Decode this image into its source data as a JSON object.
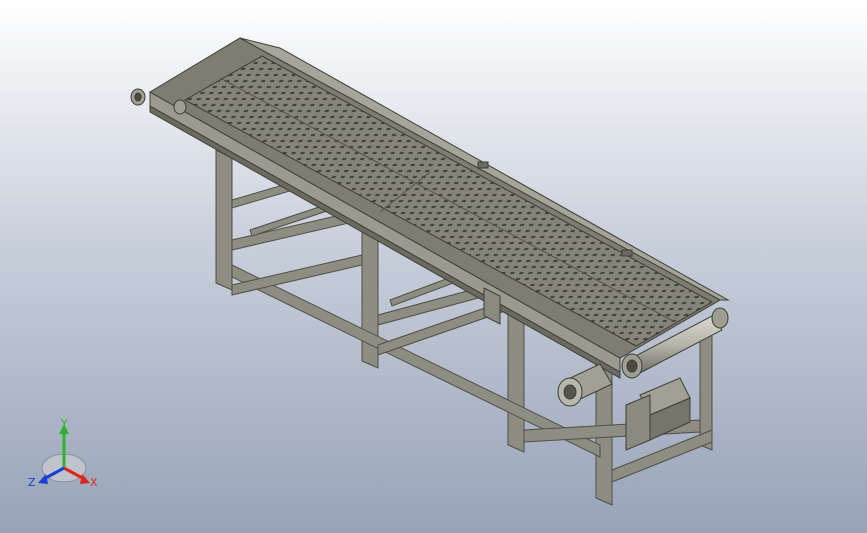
{
  "viewport": {
    "background_top": "#ffffff",
    "background_bottom": "#98a3b8"
  },
  "model": {
    "name": "belt-conveyor-assembly",
    "frame_color": "#8f8f83",
    "frame_dark": "#5c5c52",
    "belt_color": "#7d7d71",
    "roller_color": "#b4b4a8"
  },
  "triad": {
    "x_label": "X",
    "y_label": "Y",
    "z_label": "Z",
    "x_color": "#e0261b",
    "y_color": "#2db52a",
    "z_color": "#1a3fd6",
    "icon": "coordinate-triad-icon"
  }
}
